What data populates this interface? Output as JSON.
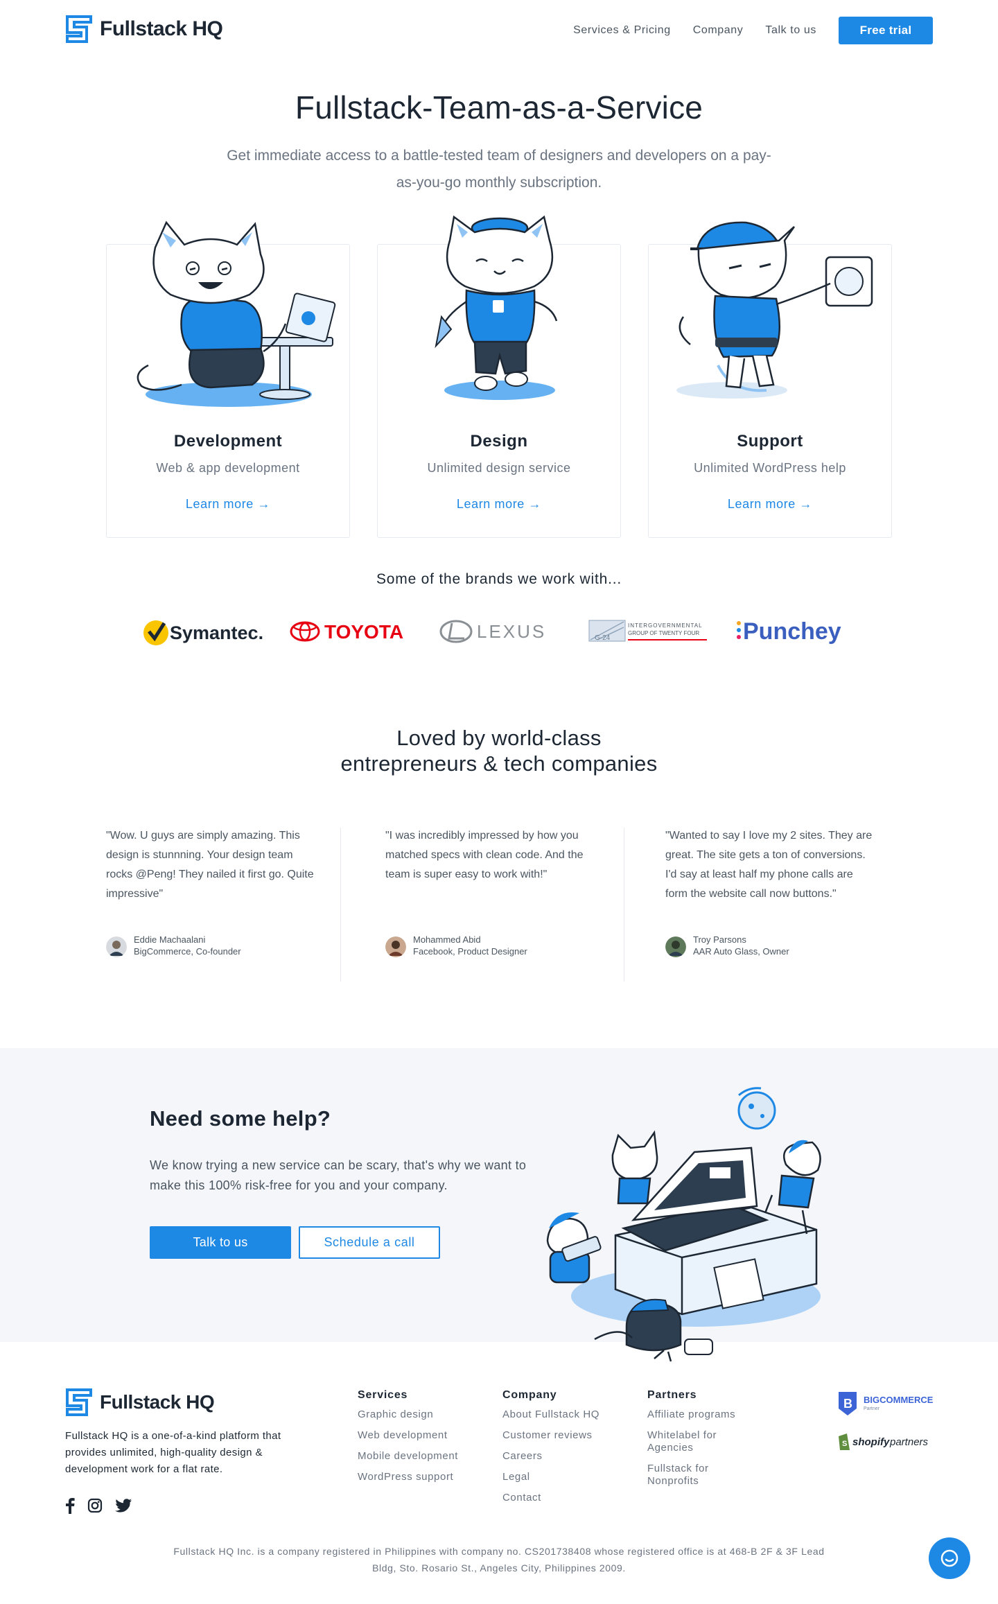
{
  "brand": {
    "name": "Fullstack HQ",
    "accent": "#1e88e5"
  },
  "nav": {
    "links": [
      "Services & Pricing",
      "Company",
      "Talk to us"
    ],
    "cta": "Free trial"
  },
  "hero": {
    "title": "Fullstack-Team-as-a-Service",
    "subtitle": "Get immediate access to a battle-tested team of designers and developers on a pay-as-you-go monthly subscription."
  },
  "services": [
    {
      "title": "Development",
      "subtitle": "Web & app development",
      "link": "Learn more →",
      "icon": "cat-developer-illustration"
    },
    {
      "title": "Design",
      "subtitle": "Unlimited design service",
      "link": "Learn more →",
      "icon": "cat-designer-illustration"
    },
    {
      "title": "Support",
      "subtitle": "Unlimited WordPress help",
      "link": "Learn more →",
      "icon": "cat-support-illustration"
    }
  ],
  "brands": {
    "title": "Some of the brands we work with...",
    "logos": [
      "Symantec.",
      "TOYOTA",
      "LEXUS",
      "INTERGOVERNMENTAL",
      "GROUP OF TWENTY FOUR",
      "G-24",
      "Punchey"
    ]
  },
  "testimonials": {
    "title_line1": "Loved by world-class",
    "title_line2": "entrepreneurs & tech companies",
    "items": [
      {
        "quote": "\"Wow. U guys are simply amazing. This design is stunnning. Your design team rocks @Peng! They nailed it first go. Quite impressive\"",
        "name": "Eddie Machaalani",
        "role": "BigCommerce, Co-founder"
      },
      {
        "quote": "\"I was incredibly impressed by how you matched specs with clean code. And the team is super easy to work with!\"",
        "name": "Mohammed Abid",
        "role": "Facebook, Product Designer"
      },
      {
        "quote": "\"Wanted to say I love my 2 sites. They are great. The site gets a ton of conversions. I'd say at least half my phone calls are form the website call now buttons.\"",
        "name": "Troy Parsons",
        "role": "AAR Auto Glass, Owner"
      }
    ]
  },
  "help": {
    "title": "Need some help?",
    "text": "We know trying a new service can be scary, that's why we want to make this 100% risk-free for you and your company.",
    "primary": "Talk to us",
    "secondary": "Schedule a call"
  },
  "footer": {
    "about": "Fullstack HQ is a one-of-a-kind platform that provides unlimited, high-quality design & development work for a flat rate.",
    "columns": [
      {
        "title": "Services",
        "items": [
          "Graphic design",
          "Web development",
          "Mobile development",
          "WordPress support"
        ]
      },
      {
        "title": "Company",
        "items": [
          "About Fullstack HQ",
          "Customer reviews",
          "Careers",
          "Legal",
          "Contact"
        ]
      },
      {
        "title": "Partners",
        "items": [
          "Affiliate programs",
          "Whitelabel for Agencies",
          "Fullstack for Nonprofits"
        ]
      }
    ],
    "partners": [
      "BIGCOMMERCE",
      "Partner",
      "shopify",
      "partners"
    ],
    "copyright": "Fullstack HQ Inc. is a company registered in Philippines with company no. CS201738408 whose registered office is at 468-B 2F & 3F Lead Bldg, Sto. Rosario St., Angeles City, Philippines 2009."
  }
}
